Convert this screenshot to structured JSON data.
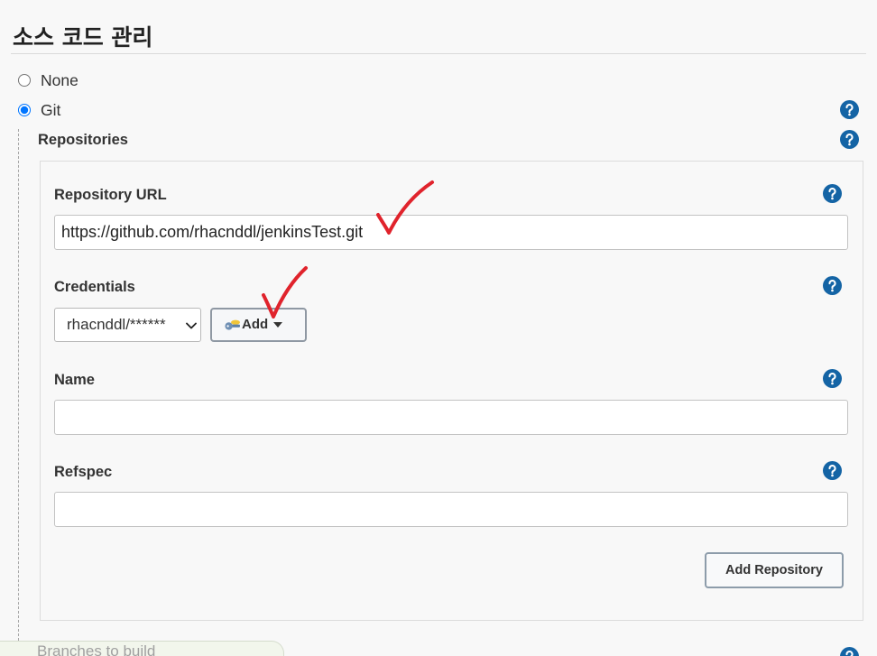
{
  "section": {
    "title": "소스 코드 관리"
  },
  "scm": {
    "options": [
      {
        "label": "None",
        "selected": false
      },
      {
        "label": "Git",
        "selected": true
      }
    ]
  },
  "repositories": {
    "label": "Repositories",
    "repository_url": {
      "label": "Repository URL",
      "value": "https://github.com/rhacnddl/jenkinsTest.git"
    },
    "credentials": {
      "label": "Credentials",
      "selected": "rhacnddl/******",
      "add_label": "Add"
    },
    "name": {
      "label": "Name",
      "value": ""
    },
    "refspec": {
      "label": "Refspec",
      "value": ""
    },
    "add_repository_label": "Add Repository"
  },
  "branches_to_build": {
    "label": "Branches to build"
  },
  "icons": {
    "help": "help-icon",
    "credential_key": "key-icon",
    "select_arrow": "chevron-down-icon",
    "add_menu_arrow": "caret-down-icon",
    "annotation": "checkmark-icon"
  },
  "colors": {
    "help_icon": "#1464a5",
    "radio_selected": "#0075ff",
    "annotation": "#e0232c",
    "text": "#333333"
  }
}
